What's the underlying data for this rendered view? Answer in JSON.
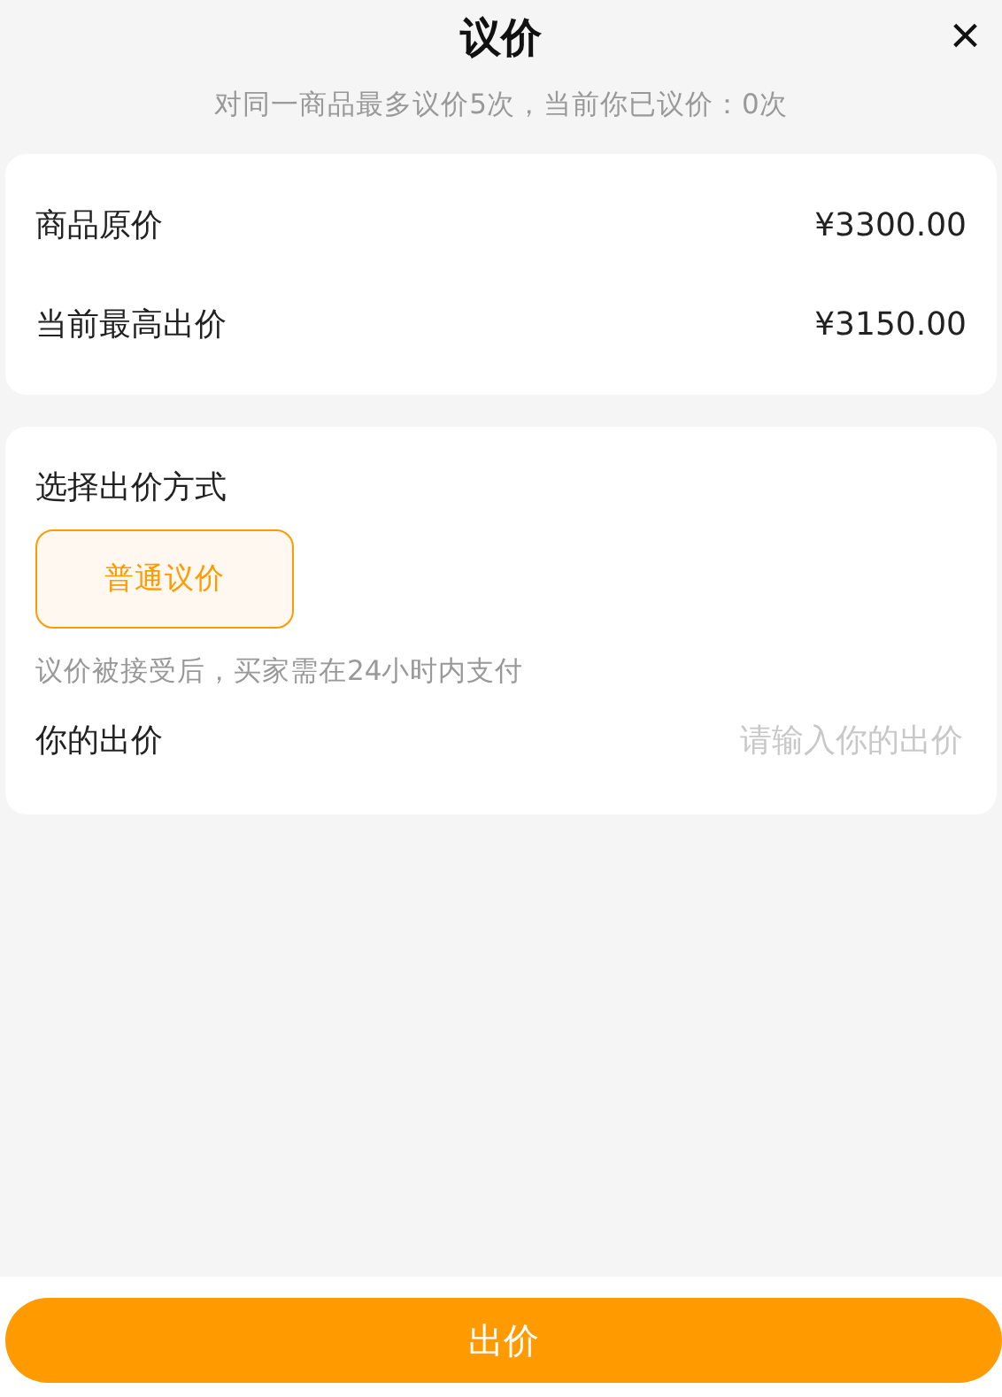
{
  "header": {
    "title": "议价",
    "close": "×"
  },
  "notice": "对同一商品最多议价5次，当前你已议价：0次",
  "price_rows": [
    {
      "label": "商品原价",
      "value": "¥3300.00"
    },
    {
      "label": "当前最高出价",
      "value": "¥3150.00"
    }
  ],
  "bid_section": {
    "title": "选择出价方式",
    "modes": [
      {
        "label": "普通议价",
        "selected": true
      }
    ],
    "hint": "议价被接受后，买家需在24小时内支付",
    "bid_field": {
      "label": "你的出价",
      "placeholder": "请输入你的出价"
    }
  },
  "submit_button": "出价"
}
